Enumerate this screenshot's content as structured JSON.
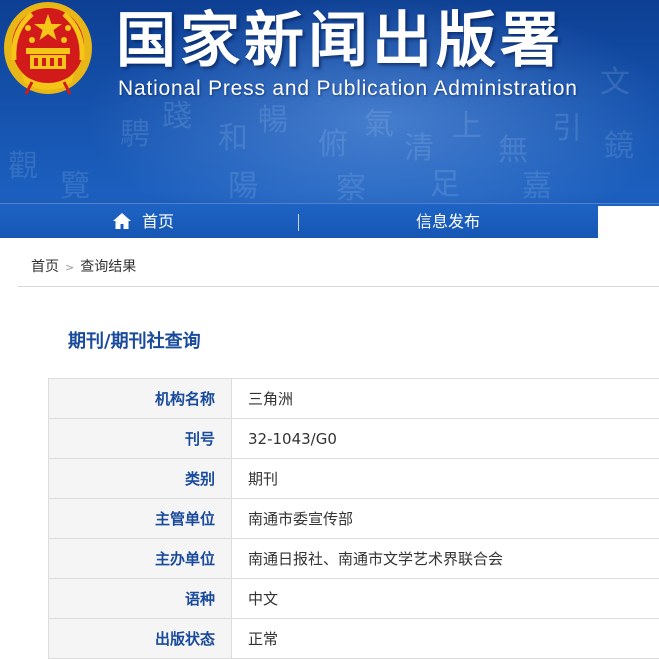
{
  "header": {
    "title": "国家新闻出版署",
    "subtitle": "National  Press and Publication Administration"
  },
  "nav": {
    "items": [
      {
        "label": "首页",
        "icon": "home-icon"
      },
      {
        "label": "信息发布"
      }
    ]
  },
  "breadcrumb": {
    "home": "首页",
    "separator": ">",
    "current": "查询结果"
  },
  "section": {
    "title": "期刊/期刊社查询"
  },
  "table": {
    "rows": [
      {
        "label": "机构名称",
        "value": "三角洲"
      },
      {
        "label": "刊号",
        "value": "32-1043/G0"
      },
      {
        "label": "类别",
        "value": "期刊"
      },
      {
        "label": "主管单位",
        "value": "南通市委宣传部"
      },
      {
        "label": "主办单位",
        "value": "南通日报社、南通市文学艺术界联合会"
      },
      {
        "label": "语种",
        "value": "中文"
      },
      {
        "label": "出版状态",
        "value": "正常"
      }
    ]
  },
  "colors": {
    "banner_blue": "#1552ad",
    "nav_blue": "#1e63c4",
    "heading_blue": "#1a4a9c",
    "emblem_red": "#d21a1a",
    "emblem_gold": "#f5c518"
  }
}
